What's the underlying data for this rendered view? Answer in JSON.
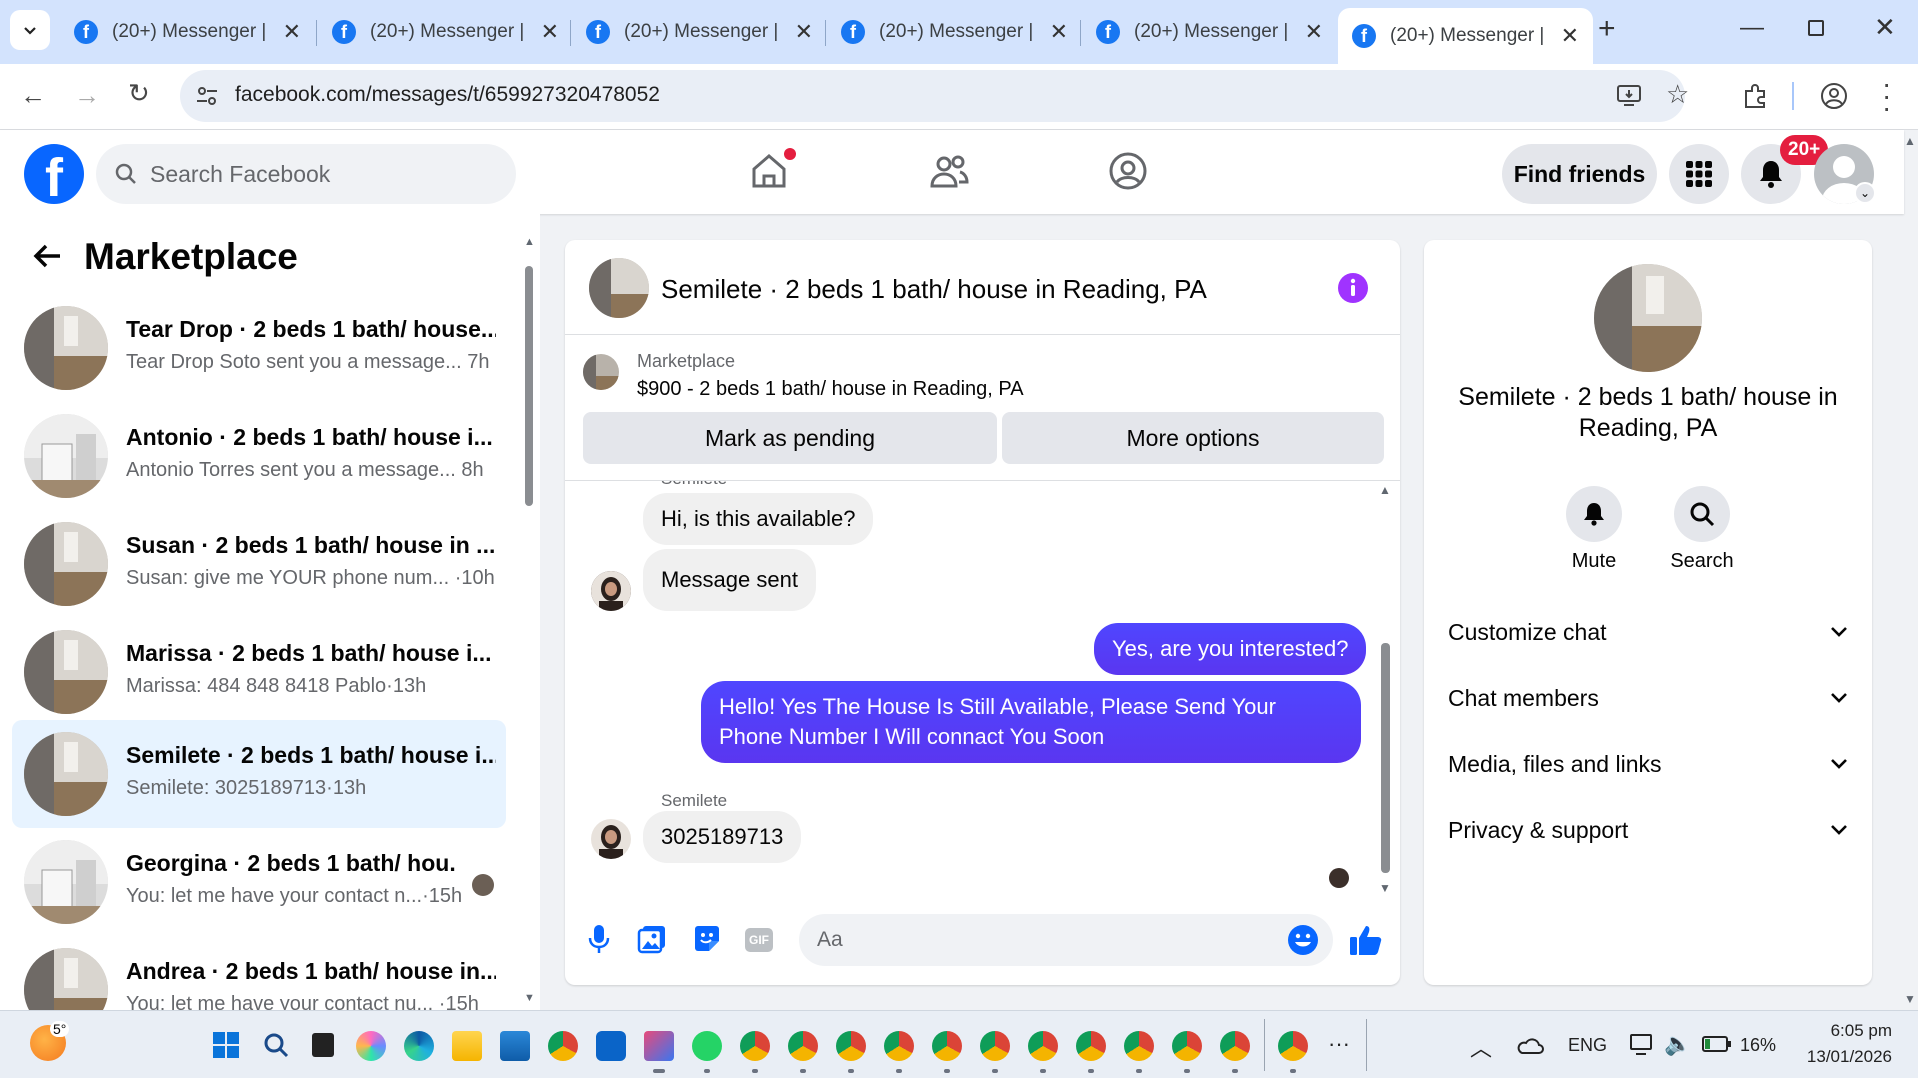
{
  "browser": {
    "tabs": [
      {
        "title": "(20+) Messenger |"
      },
      {
        "title": "(20+) Messenger |"
      },
      {
        "title": "(20+) Messenger |"
      },
      {
        "title": "(20+) Messenger |"
      },
      {
        "title": "(20+) Messenger |"
      },
      {
        "title": "(20+) Messenger |"
      }
    ],
    "url": "facebook.com/messages/t/659927320478052"
  },
  "header": {
    "search_placeholder": "Search Facebook",
    "find_friends": "Find friends",
    "notif_badge": "20+"
  },
  "sidebar": {
    "title": "Marketplace",
    "conversations": [
      {
        "name": "Tear Drop · 2 beds 1 bath/ house...",
        "preview": "Tear Drop Soto sent you a message... 7h"
      },
      {
        "name": "Antonio · 2 beds 1 bath/ house i...",
        "preview": "Antonio Torres sent you a message... 8h"
      },
      {
        "name": "Susan · 2 beds 1 bath/ house in ...",
        "preview": "Susan: give me YOUR phone num... ·10h"
      },
      {
        "name": "Marissa · 2 beds 1 bath/ house i...",
        "preview": "Marissa: 484 848 8418 Pablo·13h"
      },
      {
        "name": "Semilete · 2 beds 1 bath/ house i...",
        "preview": "Semilete: 3025189713·13h"
      },
      {
        "name": "Georgina · 2 beds 1 bath/ hou...",
        "preview": "You: let me have your contact n...·15h"
      },
      {
        "name": "Andrea · 2 beds 1 bath/ house in...",
        "preview": "You: let me have your contact nu... ·15h"
      }
    ]
  },
  "chat": {
    "title": "Semilete · 2 beds 1 bath/ house in Reading, PA",
    "listing_label": "Marketplace",
    "listing_text": "$900 - 2 beds 1 bath/ house in Reading, PA",
    "mark_pending": "Mark as pending",
    "more_options": "More options",
    "cut_label": "Semilete",
    "msg1": "Hi, is this available?",
    "msg2": "Message sent",
    "msg3": "Yes, are you interested?",
    "msg4": "Hello! Yes The House  Is Still Available, Please Send Your Phone Number I Will connact You Soon",
    "sender_label": "Semilete",
    "msg5": "3025189713",
    "composer_placeholder": "Aa"
  },
  "info": {
    "name": "Semilete · 2 beds 1 bath/ house in Reading, PA",
    "mute": "Mute",
    "search": "Search",
    "rows": [
      "Customize chat",
      "Chat members",
      "Media, files and links",
      "Privacy & support"
    ]
  },
  "taskbar": {
    "weather": "5°",
    "lang": "ENG",
    "battery": "16%",
    "time": "6:05 pm",
    "date": "13/01/2026",
    "more": "···"
  },
  "colors": {
    "fb_blue": "#0866ff",
    "messenger_purple": "#5b3cf5",
    "selected_bg": "#e7f3ff",
    "badge_red": "#e41e3f"
  }
}
